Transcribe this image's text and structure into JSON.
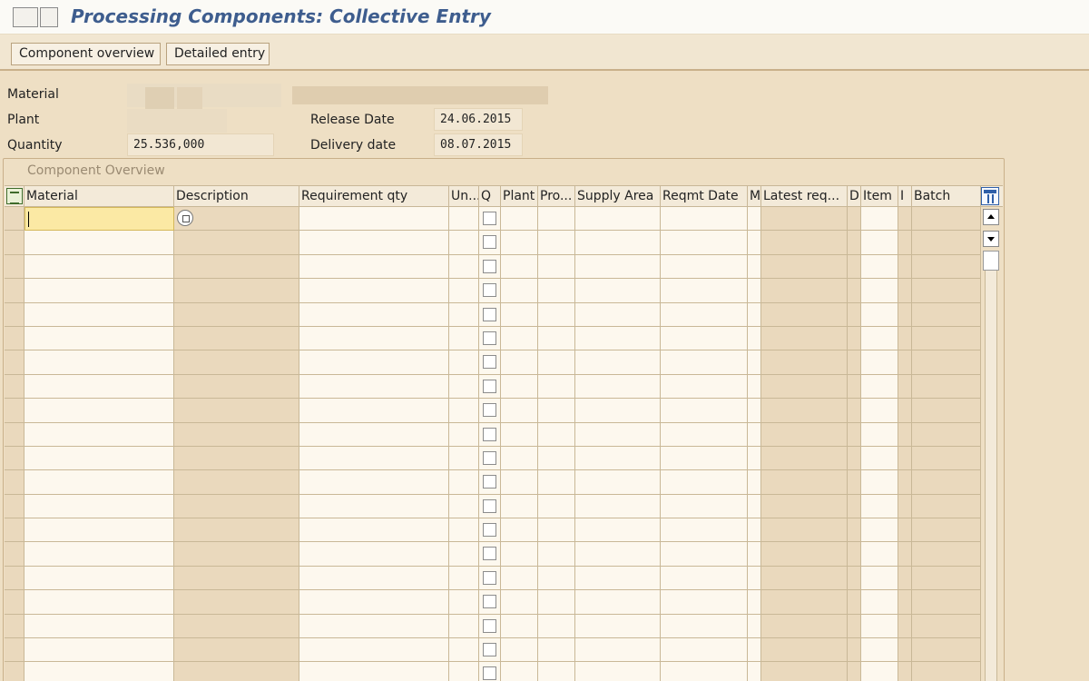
{
  "window": {
    "title": "Processing Components: Collective Entry"
  },
  "toolbar": {
    "component_overview_label": "Component overview",
    "detailed_entry_label": "Detailed entry"
  },
  "header": {
    "material_label": "Material",
    "plant_label": "Plant",
    "quantity_label": "Quantity",
    "quantity_value": "25.536,000",
    "release_date_label": "Release Date",
    "release_date_value": "24.06.2015",
    "delivery_date_label": "Delivery date",
    "delivery_date_value": "08.07.2015"
  },
  "group": {
    "title": "Component Overview"
  },
  "table": {
    "columns": {
      "material": "Material",
      "description": "Description",
      "requirement_qty": "Requirement qty",
      "unit": "Un...",
      "q": "Q",
      "plant": "Plant",
      "pro": "Pro...",
      "supply_area": "Supply Area",
      "reqmt_date": "Reqmt Date",
      "m": "M",
      "latest_req": "Latest req...",
      "d": "D",
      "item": "Item",
      "i": "I",
      "batch": "Batch"
    }
  },
  "icons": {
    "select_all": "select-all-icon",
    "column_settings": "table-settings-icon",
    "value_help": "value-help-icon",
    "scroll_up": "scroll-up-icon",
    "scroll_down": "scroll-down-icon"
  },
  "colors": {
    "title": "#3e5d8e",
    "background": "#eedfc4",
    "active_cell": "#fbe9a4"
  }
}
